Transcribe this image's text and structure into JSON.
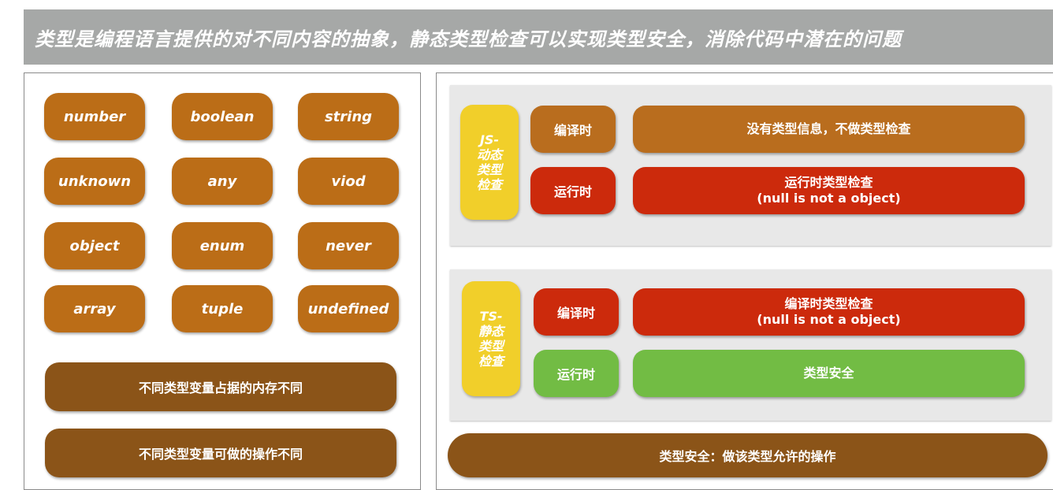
{
  "title": "类型是编程语言提供的对不同内容的抽象，静态类型检查可以实现类型安全，消除代码中潜在的问题",
  "types": [
    "number",
    "boolean",
    "string",
    "unknown",
    "any",
    "viod",
    "object",
    "enum",
    "never",
    "array",
    "tuple",
    "undefined"
  ],
  "left_notes": [
    "不同类型变量占据的内存不同",
    "不同类型变量可做的操作不同"
  ],
  "js": {
    "label_lines": [
      "JS-",
      "动态",
      "类型",
      "检查"
    ],
    "compile": {
      "stage": "编译时",
      "line1": "没有类型信息，不做类型检查",
      "line2": ""
    },
    "runtime": {
      "stage": "运行时",
      "line1": "运行时类型检查",
      "line2": "(null is not a object)"
    }
  },
  "ts": {
    "label_lines": [
      "TS-",
      "静态",
      "类型",
      "检查"
    ],
    "compile": {
      "stage": "编译时",
      "line1": "编译时类型检查",
      "line2": "(null is not a object)"
    },
    "runtime": {
      "stage": "运行时",
      "line1": "类型安全",
      "line2": ""
    }
  },
  "conclusion": "类型安全：做该类型允许的操作",
  "colors": {
    "type_pill": "#bb6d17",
    "dark_brown": "#8b5418",
    "red": "#cc2a0c",
    "green": "#72bc44",
    "yellow": "#f1cf2a",
    "banner": "#a6a8a7"
  }
}
